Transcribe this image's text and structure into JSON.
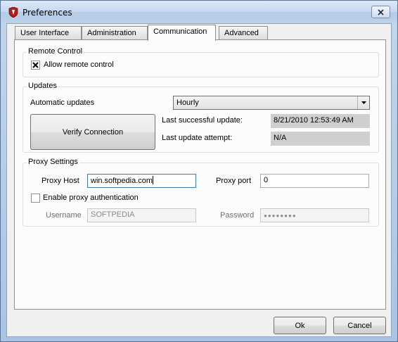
{
  "window": {
    "title": "Preferences"
  },
  "tabs": [
    {
      "label": "User Interface"
    },
    {
      "label": "Administration"
    },
    {
      "label": "Communication"
    },
    {
      "label": "Advanced"
    }
  ],
  "remote_control": {
    "group_title": "Remote Control",
    "allow_label": "Allow remote control",
    "allow_checked": true
  },
  "updates": {
    "group_title": "Updates",
    "automatic_label": "Automatic updates",
    "frequency_value": "Hourly",
    "verify_button": "Verify Connection",
    "last_success_label": "Last successful update:",
    "last_success_value": "8/21/2010 12:53:49 AM",
    "last_attempt_label": "Last update attempt:",
    "last_attempt_value": "N/A"
  },
  "proxy": {
    "group_title": "Proxy Settings",
    "host_label": "Proxy Host",
    "host_value": "win.softpedia.com",
    "port_label": "Proxy port",
    "port_value": "0",
    "auth_label": "Enable proxy authentication",
    "auth_checked": false,
    "username_label": "Username",
    "username_value": "SOFTPEDIA",
    "password_label": "Password",
    "password_value": "●●●●●●●●"
  },
  "buttons": {
    "ok": "Ok",
    "cancel": "Cancel"
  },
  "icons": {
    "app": "shield-icon",
    "close": "close-icon",
    "dropdown": "chevron-down-icon",
    "check": "checkmark-icon"
  }
}
